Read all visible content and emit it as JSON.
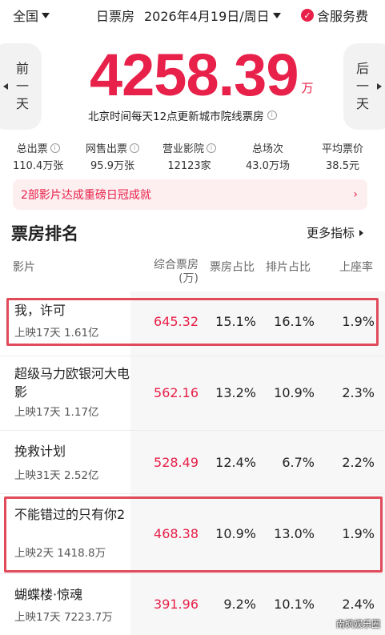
{
  "topbar": {
    "city": "全国",
    "day_type": "日票房",
    "date": "2026年4月19日/周日",
    "service_fee": "含服务费"
  },
  "hero": {
    "prev_label": [
      "前",
      "一",
      "天"
    ],
    "next_label": [
      "后",
      "一",
      "天"
    ],
    "total_box_office": "4258.39",
    "unit": "万",
    "note": "北京时间每天12点更新城市院线票房"
  },
  "stats": [
    {
      "label": "总出票",
      "value": "110.4万张",
      "info": true
    },
    {
      "label": "网售出票",
      "value": "95.9万张",
      "info": true
    },
    {
      "label": "营业影院",
      "value": "12123家",
      "info": true
    },
    {
      "label": "总场次",
      "value": "43.0万场",
      "info": false
    },
    {
      "label": "平均票价",
      "value": "38.5元",
      "info": false
    }
  ],
  "banner": {
    "text": "2部影片达成重磅日冠成就",
    "arrow": "›"
  },
  "section": {
    "title": "票房排名",
    "more": "更多指标"
  },
  "table": {
    "headers": {
      "film": "影片",
      "box_office_line1": "综合票房",
      "box_office_line2": "(万)",
      "bo_share": "票房占比",
      "screen_share": "排片占比",
      "occupancy": "上座率"
    },
    "rows": [
      {
        "name": "我，许可",
        "sub": "上映17天  1.61亿",
        "box_office": "645.32",
        "bo_share": "15.1%",
        "screen_share": "16.1%",
        "occupancy": "1.9%",
        "highlight": true
      },
      {
        "name": "超级马力欧银河大电影",
        "sub": "上映17天  1.17亿",
        "box_office": "562.16",
        "bo_share": "13.2%",
        "screen_share": "10.9%",
        "occupancy": "2.3%",
        "highlight": false
      },
      {
        "name": "挽救计划",
        "sub": "上映31天  2.52亿",
        "box_office": "528.49",
        "bo_share": "12.4%",
        "screen_share": "6.7%",
        "occupancy": "2.2%",
        "highlight": false
      },
      {
        "name": "不能错过的只有你2",
        "sub": "上映2天  1418.8万",
        "box_office": "468.38",
        "bo_share": "10.9%",
        "screen_share": "13.0%",
        "occupancy": "1.9%",
        "highlight": true
      },
      {
        "name": "蝴蝶楼·惊魂",
        "sub": "上映17天  7223.7万",
        "box_office": "391.96",
        "bo_share": "9.2%",
        "screen_share": "10.1%",
        "occupancy": "2.4%",
        "highlight": false
      }
    ]
  },
  "watermark": "南枫娱乐圈",
  "colors": {
    "accent": "#e8214a",
    "highlight_border": "#e04a5a",
    "banner_bg": "#fdeef0"
  }
}
